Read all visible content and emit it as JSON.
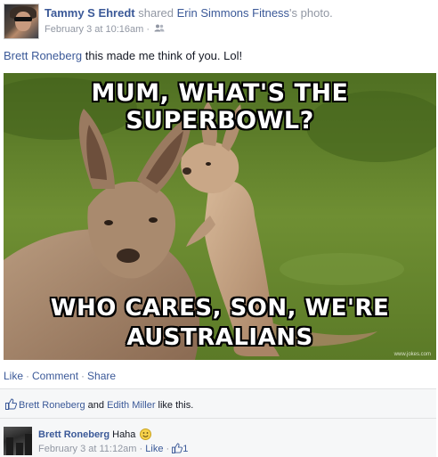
{
  "post": {
    "author": "Tammy S Ehredt",
    "shared_word": "shared",
    "source_page": "Erin Simmons Fitness",
    "source_suffix": "'s photo.",
    "timestamp": "February 3 at 10:16am",
    "meta_sep": "·",
    "audience_icon": "friends-icon",
    "mention": "Brett Roneberg",
    "text": " this made me think of you. Lol!"
  },
  "photo": {
    "caption_top": "MUM, WHAT'S THE SUPERBOWL?",
    "caption_bottom_1": "WHO CARES, SON, WE'RE",
    "caption_bottom_2": "AUSTRALIANS",
    "watermark": "www.jokes.com"
  },
  "actions": {
    "like": "Like",
    "comment": "Comment",
    "share": "Share",
    "sep": "·"
  },
  "likes": {
    "icon": "thumbs-up-icon",
    "person1": "Brett Roneberg",
    "and": " and ",
    "person2": "Edith Miller",
    "suffix": " like this."
  },
  "comment": {
    "author": "Brett Roneberg",
    "text": "Haha",
    "emoji": "smiley-icon",
    "timestamp": "February 3 at 11:12am",
    "sep": "·",
    "like_label": "Like",
    "like_count": "1"
  },
  "colors": {
    "link": "#3b5998",
    "muted": "#9197a3",
    "ufi_bg": "#f6f7f8"
  }
}
